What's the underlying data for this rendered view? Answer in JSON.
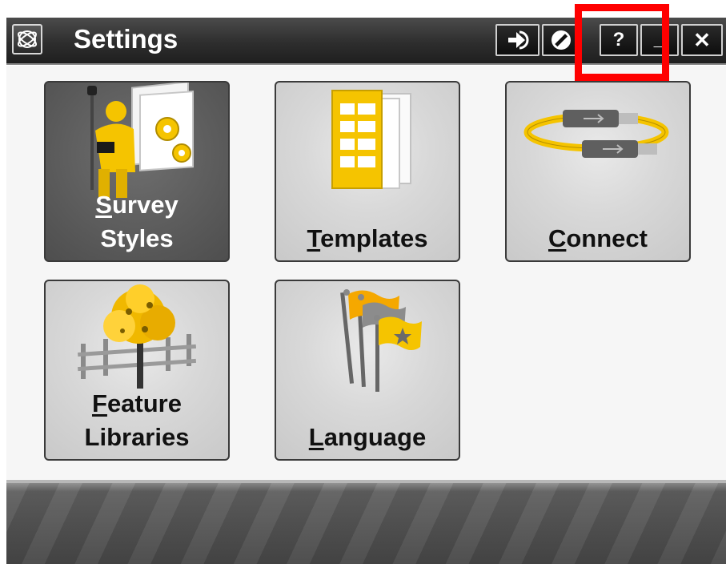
{
  "window": {
    "title": "Settings",
    "app_icon": "trimble-globe-icon",
    "buttons": [
      {
        "name": "switch-to-button",
        "icon": "arrow-right-icon"
      },
      {
        "name": "no-entry-button",
        "icon": "prohibited-icon"
      },
      {
        "name": "help-button",
        "label": "?"
      },
      {
        "name": "minimize-button",
        "label": "_"
      },
      {
        "name": "close-button",
        "label": "✕"
      }
    ]
  },
  "tiles": [
    {
      "id": "survey-styles",
      "line1_accel": "S",
      "line1_rest": "urvey",
      "line2": "Styles",
      "selected": true,
      "icon": "surveyor-with-gears-icon"
    },
    {
      "id": "templates",
      "line1_accel": "T",
      "line1_rest": "emplates",
      "selected": false,
      "icon": "template-documents-icon"
    },
    {
      "id": "connect",
      "line1_accel": "C",
      "line1_rest": "onnect",
      "selected": false,
      "icon": "usb-cable-icon"
    },
    {
      "id": "feature-libraries",
      "line1_accel": "F",
      "line1_rest": "eature",
      "line2": "Libraries",
      "selected": false,
      "icon": "tree-and-fence-icon"
    },
    {
      "id": "language",
      "line1_accel": "L",
      "line1_rest": "anguage",
      "selected": false,
      "icon": "flags-icon"
    }
  ],
  "colors": {
    "accent_yellow": "#f5c400",
    "highlight_red": "#ff0000",
    "titlebar_bg": "#2e2e2e"
  }
}
